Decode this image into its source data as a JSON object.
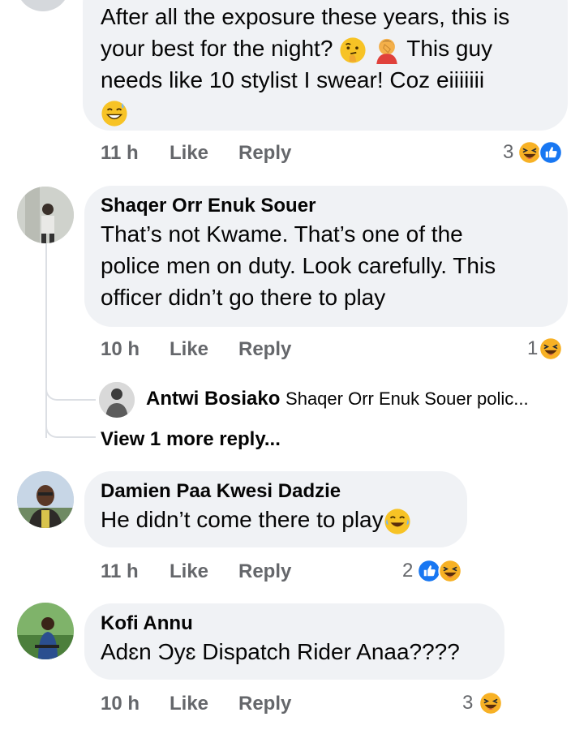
{
  "comments": [
    {
      "lines": [
        "After all the exposure these years, this is",
        "your best for the night?",
        "This guy",
        "needs like 10 stylist I swear! Coz eiiiiiii"
      ],
      "time": "11 h",
      "like": "Like",
      "reply": "Reply",
      "reaction_count": "3",
      "reactions": [
        "haha-icon",
        "like-icon"
      ]
    },
    {
      "author": "Shaqer Orr Enuk Souer",
      "lines": [
        "That’s not Kwame. That’s one of the",
        "police men on duty. Look carefully. This",
        "officer didn’t go there to play"
      ],
      "time": "10 h",
      "like": "Like",
      "reply": "Reply",
      "reaction_count": "1",
      "reactions": [
        "haha-icon"
      ],
      "reply_preview": {
        "author": "Antwi Bosiako",
        "text": "Shaqer Orr Enuk Souer polic..."
      },
      "view_more": "View 1 more reply..."
    },
    {
      "author": "Damien Paa Kwesi Dadzie",
      "lines": [
        "He didn’t come there to play"
      ],
      "time": "11 h",
      "like": "Like",
      "reply": "Reply",
      "reaction_count": "2",
      "reactions": [
        "like-icon",
        "haha-icon"
      ]
    },
    {
      "author": "Kofi Annu",
      "lines": [
        "Adɛn Ɔyɛ Dispatch Rider Anaa????"
      ],
      "time": "10 h",
      "like": "Like",
      "reply": "Reply",
      "reaction_count": "3",
      "reactions": [
        "haha-icon"
      ]
    }
  ],
  "colors": {
    "bubble": "#f0f2f5",
    "meta": "#65676b",
    "like_blue": "#1877f2",
    "haha_yellow": "#f7b125"
  }
}
